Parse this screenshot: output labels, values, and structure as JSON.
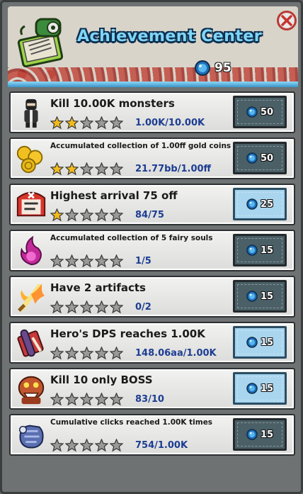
{
  "header": {
    "title": "Achievement Center",
    "gem_count": "95",
    "logo_icon": "scroll-book-icon",
    "close_icon": "close-x-icon"
  },
  "colors": {
    "title": "#7fd6f7",
    "progress": "#1c3d92",
    "star_gold": "#f2bb1c",
    "star_gray": "#9a9a9a"
  },
  "achievements": [
    {
      "title": "Kill 10.00K monsters",
      "progress": "1.00K/10.00K",
      "stars_filled": 2,
      "stars_total": 5,
      "reward": "50",
      "claimable": false,
      "icon": "ninja-icon"
    },
    {
      "title": "Accumulated collection of 1.00ff gold coins",
      "progress": "21.77bb/1.00ff",
      "stars_filled": 2,
      "stars_total": 5,
      "reward": "50",
      "claimable": false,
      "icon": "gold-coins-icon"
    },
    {
      "title": "Highest arrival 75 off",
      "progress": "84/75",
      "stars_filled": 1,
      "stars_total": 5,
      "reward": "25",
      "claimable": true,
      "icon": "red-hood-icon"
    },
    {
      "title": "Accumulated collection of 5 fairy souls",
      "progress": "1/5",
      "stars_filled": 0,
      "stars_total": 5,
      "reward": "15",
      "claimable": false,
      "icon": "fairy-soul-flame-icon"
    },
    {
      "title": "Have 2 artifacts",
      "progress": "0/2",
      "stars_filled": 0,
      "stars_total": 5,
      "reward": "15",
      "claimable": false,
      "icon": "fire-sword-icon"
    },
    {
      "title": "Hero's DPS reaches 1.00K",
      "progress": "148.06aa/1.00K",
      "stars_filled": 0,
      "stars_total": 5,
      "reward": "15",
      "claimable": true,
      "icon": "scroll-icon"
    },
    {
      "title": "Kill 10 only BOSS",
      "progress": "83/10",
      "stars_filled": 0,
      "stars_total": 5,
      "reward": "15",
      "claimable": true,
      "icon": "boss-monster-icon"
    },
    {
      "title": "Cumulative clicks reached 1.00K times",
      "progress": "754/1.00K",
      "stars_filled": 0,
      "stars_total": 5,
      "reward": "15",
      "claimable": false,
      "icon": "armored-fist-icon"
    }
  ]
}
